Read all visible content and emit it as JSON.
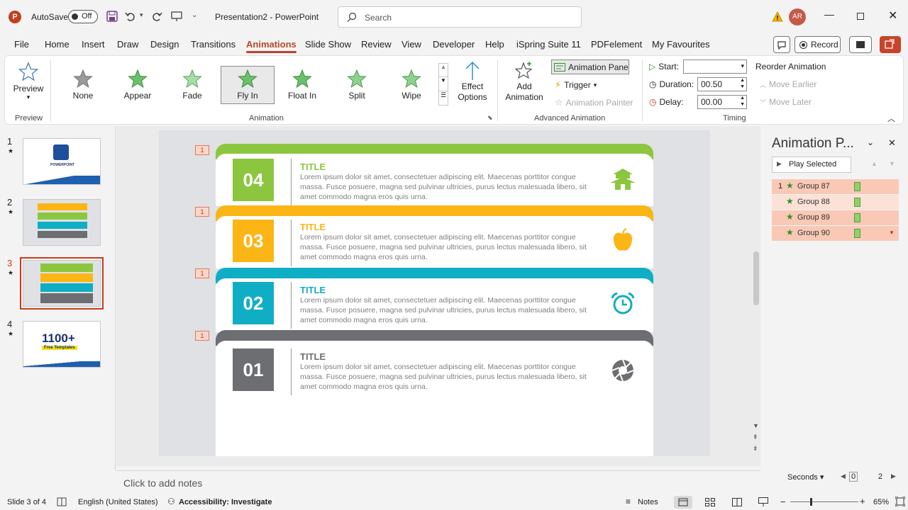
{
  "titlebar": {
    "autosave_label": "AutoSave",
    "autosave_state": "Off",
    "doc_title": "Presentation2 - PowerPoint",
    "search_placeholder": "Search",
    "user_initials": "AR"
  },
  "tabs": [
    "File",
    "Home",
    "Insert",
    "Draw",
    "Design",
    "Transitions",
    "Animations",
    "Slide Show",
    "Review",
    "View",
    "Developer",
    "Help",
    "iSpring Suite 11",
    "PDFelement",
    "My Favourites"
  ],
  "active_tab": "Animations",
  "record_label": "Record",
  "ribbon": {
    "preview_label": "Preview",
    "preview_group": "Preview",
    "gallery": [
      "None",
      "Appear",
      "Fade",
      "Fly In",
      "Float In",
      "Split",
      "Wipe"
    ],
    "selected_effect": "Fly In",
    "animation_group": "Animation",
    "effect_options": "Effect Options",
    "add_animation": "Add Animation",
    "animation_pane": "Animation Pane",
    "trigger": "Trigger",
    "animation_painter": "Animation Painter",
    "advanced_group": "Advanced Animation",
    "start_label": "Start:",
    "start_value": "",
    "duration_label": "Duration:",
    "duration_value": "00.50",
    "delay_label": "Delay:",
    "delay_value": "00.00",
    "reorder": "Reorder Animation",
    "move_earlier": "Move Earlier",
    "move_later": "Move Later",
    "timing_group": "Timing"
  },
  "slides": [
    {
      "num": "1",
      "star": "★"
    },
    {
      "num": "2",
      "star": "★"
    },
    {
      "num": "3",
      "star": "★"
    },
    {
      "num": "4",
      "star": "★"
    }
  ],
  "thumb4": {
    "big": "1100+",
    "sub": "Free Templates"
  },
  "thumb1": {
    "text": "POWERPOINT"
  },
  "slide": {
    "tag": "1",
    "cards": [
      {
        "num": "04",
        "title": "TITLE",
        "color": "#8cc63f",
        "body": "Lorem ipsum dolor sit amet, consectetuer adipiscing elit. Maecenas porttitor congue massa. Fusce posuere, magna sed pulvinar ultricies, purus lectus malesuada libero, sit amet commodo magna eros quis urna.",
        "icon": "pagoda-icon"
      },
      {
        "num": "03",
        "title": "TITLE",
        "color": "#fbb515",
        "body": "Lorem ipsum dolor sit amet, consectetuer adipiscing elit. Maecenas porttitor congue massa. Fusce posuere, magna sed pulvinar ultricies, purus lectus malesuada libero, sit amet commodo magna eros quis urna.",
        "icon": "apple-icon"
      },
      {
        "num": "02",
        "title": "TITLE",
        "color": "#10aec4",
        "body": "Lorem ipsum dolor sit amet, consectetuer adipiscing elit. Maecenas porttitor congue massa. Fusce posuere, magna sed pulvinar ultricies, purus lectus malesuada libero, sit amet commodo magna eros quis urna.",
        "icon": "alarm-clock-icon"
      },
      {
        "num": "01",
        "title": "TITLE",
        "color": "#6d6e71",
        "body": "Lorem ipsum dolor sit amet, consectetuer adipiscing elit. Maecenas porttitor congue massa. Fusce posuere, magna sed pulvinar ultricies, purus lectus malesuada libero, sit amet commodo magna eros quis urna.",
        "icon": "aperture-icon"
      }
    ]
  },
  "notes_placeholder": "Click to add notes",
  "pane": {
    "title": "Animation P...",
    "play_selected": "Play Selected",
    "index": "1",
    "items": [
      "Group 87",
      "Group 88",
      "Group 89",
      "Group 90"
    ],
    "seconds": "Seconds",
    "scale": [
      "0",
      "2"
    ]
  },
  "status": {
    "slide": "Slide 3 of 4",
    "language": "English (United States)",
    "accessibility": "Accessibility: Investigate",
    "notes": "Notes",
    "zoom": "65%"
  }
}
